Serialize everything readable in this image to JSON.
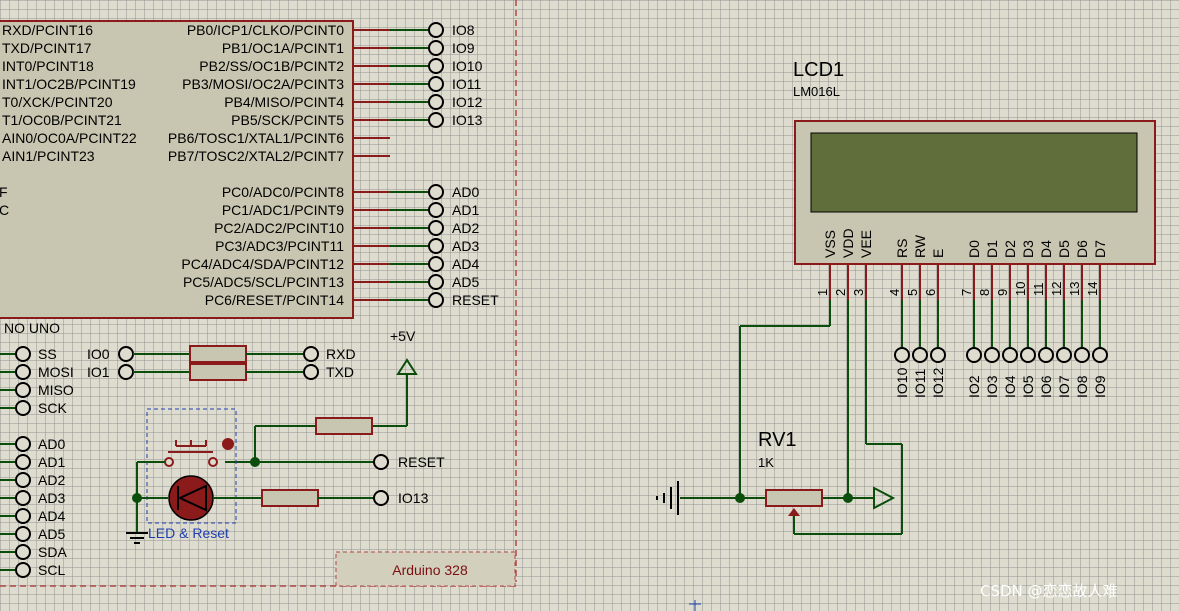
{
  "mcu": {
    "left_pins": [
      "RXD/PCINT16",
      "TXD/PCINT17",
      "INT0/PCINT18",
      "INT1/OC2B/PCINT19",
      "T0/XCK/PCINT20",
      "T1/OC0B/PCINT21",
      "AIN0/OC0A/PCINT22",
      "AIN1/PCINT23"
    ],
    "left_frag_1": "F",
    "left_frag_2": "C",
    "portb": [
      "PB0/ICP1/CLKO/PCINT0",
      "PB1/OC1A/PCINT1",
      "PB2/SS/OC1B/PCINT2",
      "PB3/MOSI/OC2A/PCINT3",
      "PB4/MISO/PCINT4",
      "PB5/SCK/PCINT5",
      "PB6/TOSC1/XTAL1/PCINT6",
      "PB7/TOSC2/XTAL2/PCINT7"
    ],
    "portc": [
      "PC0/ADC0/PCINT8",
      "PC1/ADC1/PCINT9",
      "PC2/ADC2/PCINT10",
      "PC3/ADC3/PCINT11",
      "PC4/ADC4/SDA/PCINT12",
      "PC5/ADC5/SCL/PCINT13",
      "PC6/RESET/PCINT14"
    ],
    "portb_terms": [
      "IO8",
      "IO9",
      "IO10",
      "IO11",
      "IO12",
      "IO13"
    ],
    "portc_terms": [
      "AD0",
      "AD1",
      "AD2",
      "AD3",
      "AD4",
      "AD5",
      "RESET"
    ],
    "board_name": "NO UNO"
  },
  "header_left": [
    "SS",
    "MOSI",
    "MISO",
    "SCK"
  ],
  "analog_left": [
    "AD0",
    "AD1",
    "AD2",
    "AD3",
    "AD4",
    "AD5",
    "SDA",
    "SCL"
  ],
  "serial": {
    "in": [
      "IO0",
      "IO1"
    ],
    "out": [
      "RXD",
      "TXD"
    ]
  },
  "power_label": "+5V",
  "reset_terminal": "RESET",
  "led_terminal": "IO13",
  "led_group_label": "LED & Reset",
  "sheet_label": "Arduino 328",
  "lcd": {
    "ref": "LCD1",
    "model": "LM016L",
    "pin_names": [
      "VSS",
      "VDD",
      "VEE",
      "RS",
      "RW",
      "E",
      "D0",
      "D1",
      "D2",
      "D3",
      "D4",
      "D5",
      "D6",
      "D7"
    ],
    "pin_numbers": [
      "1",
      "2",
      "3",
      "4",
      "5",
      "6",
      "7",
      "8",
      "9",
      "10",
      "11",
      "12",
      "13",
      "14"
    ],
    "ctrl_terms": [
      "IO10",
      "IO11",
      "IO12"
    ],
    "data_terms": [
      "IO2",
      "IO3",
      "IO4",
      "IO5",
      "IO6",
      "IO7",
      "IO8",
      "IO9"
    ]
  },
  "pot": {
    "ref": "RV1",
    "value": "1K"
  },
  "watermark": "CSDN @恋恋故人难",
  "colors": {
    "wire": "#0b4d0b",
    "component": "#8b1a1a",
    "background": "#dddcce",
    "body": "#c8c6b0",
    "lcd_screen": "#5f6e3a"
  }
}
